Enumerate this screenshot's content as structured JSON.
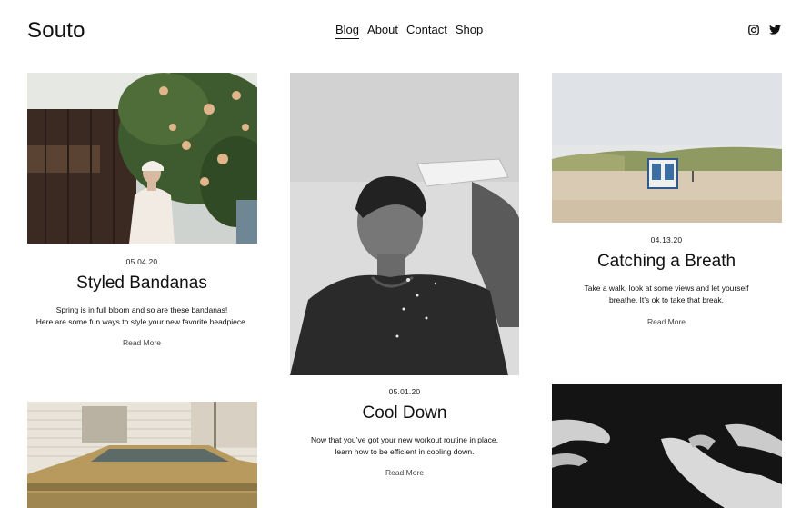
{
  "site": {
    "title": "Souto"
  },
  "nav": {
    "items": [
      {
        "label": "Blog",
        "active": true
      },
      {
        "label": "About",
        "active": false
      },
      {
        "label": "Contact",
        "active": false
      },
      {
        "label": "Shop",
        "active": false
      }
    ]
  },
  "social": {
    "instagram_icon": "instagram-icon",
    "twitter_icon": "twitter-icon"
  },
  "posts": [
    {
      "date": "05.04.20",
      "title": "Styled Bandanas",
      "excerpt": [
        "Spring is in full bloom and so are these bandanas!",
        "Here are some fun ways to style your new favorite headpiece."
      ],
      "read_more": "Read More"
    },
    {
      "date": "05.01.20",
      "title": "Cool Down",
      "excerpt": [
        "Now that you’ve got your new workout routine in place,",
        "learn how to be efficient in cooling down."
      ],
      "read_more": "Read More"
    },
    {
      "date": "04.13.20",
      "title": "Catching a Breath",
      "excerpt": [
        "Take a walk, look at some views and let yourself",
        "breathe. It’s ok to take that break."
      ],
      "read_more": "Read More"
    }
  ],
  "colors": {
    "text": "#111111",
    "background": "#ffffff",
    "muted": "#444444"
  }
}
